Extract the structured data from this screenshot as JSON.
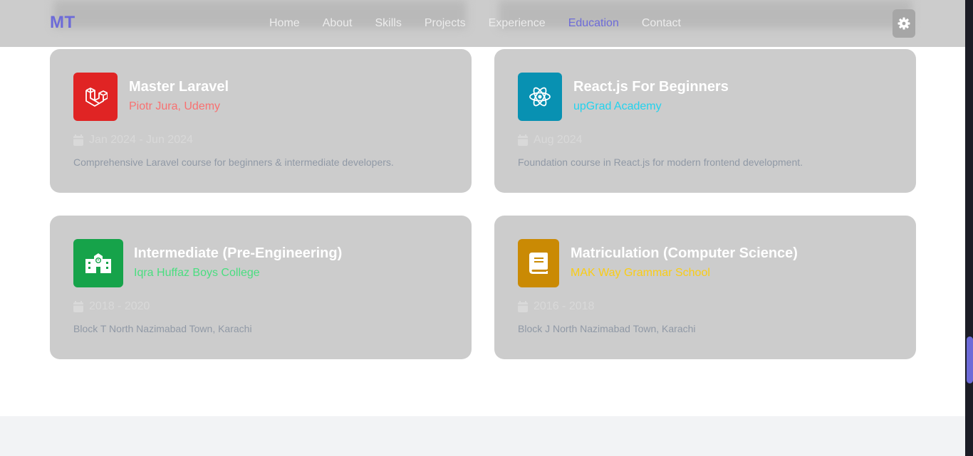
{
  "nav": {
    "logo": "MT",
    "links": [
      "Home",
      "About",
      "Skills",
      "Projects",
      "Experience",
      "Education",
      "Contact"
    ],
    "active": "Education",
    "theme_toggle_icon": "gear-icon"
  },
  "colors": {
    "accent": "#6d6bd8",
    "card_bg": "#cccccc",
    "laravel": "#e02424",
    "react": "#0891b2",
    "college": "#16a34a",
    "school": "#ca8a04"
  },
  "education": [
    {
      "title": "Master Laravel",
      "institution": "Piotr Jura, Udemy",
      "institution_color": "#f87171",
      "date": "Jan 2024 - Jun 2024",
      "description": "Comprehensive Laravel course for beginners & intermediate developers.",
      "icon": "laravel-icon"
    },
    {
      "title": "React.js For Beginners",
      "institution": "upGrad Academy",
      "institution_color": "#22d3ee",
      "date": "Aug 2024",
      "description": "Foundation course in React.js for modern frontend development.",
      "icon": "react-icon"
    },
    {
      "title": "Intermediate (Pre-Engineering)",
      "institution": "Iqra Huffaz Boys College",
      "institution_color": "#4ade80",
      "date": "2018 - 2020",
      "description": "Block T North Nazimabad Town, Karachi",
      "icon": "school-building-icon"
    },
    {
      "title": "Matriculation (Computer Science)",
      "institution": "MAK Way Grammar School",
      "institution_color": "#facc15",
      "date": "2016 - 2018",
      "description": "Block J North Nazimabad Town, Karachi",
      "icon": "book-icon"
    }
  ]
}
